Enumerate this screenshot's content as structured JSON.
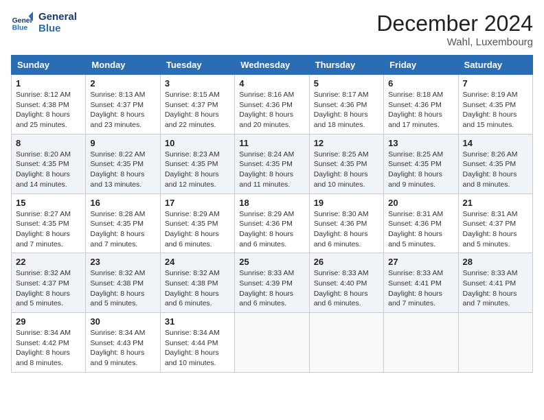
{
  "logo": {
    "line1": "General",
    "line2": "Blue"
  },
  "title": "December 2024",
  "location": "Wahl, Luxembourg",
  "days_of_week": [
    "Sunday",
    "Monday",
    "Tuesday",
    "Wednesday",
    "Thursday",
    "Friday",
    "Saturday"
  ],
  "weeks": [
    [
      {
        "day": "1",
        "info": "Sunrise: 8:12 AM\nSunset: 4:38 PM\nDaylight: 8 hours\nand 25 minutes."
      },
      {
        "day": "2",
        "info": "Sunrise: 8:13 AM\nSunset: 4:37 PM\nDaylight: 8 hours\nand 23 minutes."
      },
      {
        "day": "3",
        "info": "Sunrise: 8:15 AM\nSunset: 4:37 PM\nDaylight: 8 hours\nand 22 minutes."
      },
      {
        "day": "4",
        "info": "Sunrise: 8:16 AM\nSunset: 4:36 PM\nDaylight: 8 hours\nand 20 minutes."
      },
      {
        "day": "5",
        "info": "Sunrise: 8:17 AM\nSunset: 4:36 PM\nDaylight: 8 hours\nand 18 minutes."
      },
      {
        "day": "6",
        "info": "Sunrise: 8:18 AM\nSunset: 4:36 PM\nDaylight: 8 hours\nand 17 minutes."
      },
      {
        "day": "7",
        "info": "Sunrise: 8:19 AM\nSunset: 4:35 PM\nDaylight: 8 hours\nand 15 minutes."
      }
    ],
    [
      {
        "day": "8",
        "info": "Sunrise: 8:20 AM\nSunset: 4:35 PM\nDaylight: 8 hours\nand 14 minutes."
      },
      {
        "day": "9",
        "info": "Sunrise: 8:22 AM\nSunset: 4:35 PM\nDaylight: 8 hours\nand 13 minutes."
      },
      {
        "day": "10",
        "info": "Sunrise: 8:23 AM\nSunset: 4:35 PM\nDaylight: 8 hours\nand 12 minutes."
      },
      {
        "day": "11",
        "info": "Sunrise: 8:24 AM\nSunset: 4:35 PM\nDaylight: 8 hours\nand 11 minutes."
      },
      {
        "day": "12",
        "info": "Sunrise: 8:25 AM\nSunset: 4:35 PM\nDaylight: 8 hours\nand 10 minutes."
      },
      {
        "day": "13",
        "info": "Sunrise: 8:25 AM\nSunset: 4:35 PM\nDaylight: 8 hours\nand 9 minutes."
      },
      {
        "day": "14",
        "info": "Sunrise: 8:26 AM\nSunset: 4:35 PM\nDaylight: 8 hours\nand 8 minutes."
      }
    ],
    [
      {
        "day": "15",
        "info": "Sunrise: 8:27 AM\nSunset: 4:35 PM\nDaylight: 8 hours\nand 7 minutes."
      },
      {
        "day": "16",
        "info": "Sunrise: 8:28 AM\nSunset: 4:35 PM\nDaylight: 8 hours\nand 7 minutes."
      },
      {
        "day": "17",
        "info": "Sunrise: 8:29 AM\nSunset: 4:35 PM\nDaylight: 8 hours\nand 6 minutes."
      },
      {
        "day": "18",
        "info": "Sunrise: 8:29 AM\nSunset: 4:36 PM\nDaylight: 8 hours\nand 6 minutes."
      },
      {
        "day": "19",
        "info": "Sunrise: 8:30 AM\nSunset: 4:36 PM\nDaylight: 8 hours\nand 6 minutes."
      },
      {
        "day": "20",
        "info": "Sunrise: 8:31 AM\nSunset: 4:36 PM\nDaylight: 8 hours\nand 5 minutes."
      },
      {
        "day": "21",
        "info": "Sunrise: 8:31 AM\nSunset: 4:37 PM\nDaylight: 8 hours\nand 5 minutes."
      }
    ],
    [
      {
        "day": "22",
        "info": "Sunrise: 8:32 AM\nSunset: 4:37 PM\nDaylight: 8 hours\nand 5 minutes."
      },
      {
        "day": "23",
        "info": "Sunrise: 8:32 AM\nSunset: 4:38 PM\nDaylight: 8 hours\nand 5 minutes."
      },
      {
        "day": "24",
        "info": "Sunrise: 8:32 AM\nSunset: 4:38 PM\nDaylight: 8 hours\nand 6 minutes."
      },
      {
        "day": "25",
        "info": "Sunrise: 8:33 AM\nSunset: 4:39 PM\nDaylight: 8 hours\nand 6 minutes."
      },
      {
        "day": "26",
        "info": "Sunrise: 8:33 AM\nSunset: 4:40 PM\nDaylight: 8 hours\nand 6 minutes."
      },
      {
        "day": "27",
        "info": "Sunrise: 8:33 AM\nSunset: 4:41 PM\nDaylight: 8 hours\nand 7 minutes."
      },
      {
        "day": "28",
        "info": "Sunrise: 8:33 AM\nSunset: 4:41 PM\nDaylight: 8 hours\nand 7 minutes."
      }
    ],
    [
      {
        "day": "29",
        "info": "Sunrise: 8:34 AM\nSunset: 4:42 PM\nDaylight: 8 hours\nand 8 minutes."
      },
      {
        "day": "30",
        "info": "Sunrise: 8:34 AM\nSunset: 4:43 PM\nDaylight: 8 hours\nand 9 minutes."
      },
      {
        "day": "31",
        "info": "Sunrise: 8:34 AM\nSunset: 4:44 PM\nDaylight: 8 hours\nand 10 minutes."
      },
      {
        "day": "",
        "info": ""
      },
      {
        "day": "",
        "info": ""
      },
      {
        "day": "",
        "info": ""
      },
      {
        "day": "",
        "info": ""
      }
    ]
  ]
}
